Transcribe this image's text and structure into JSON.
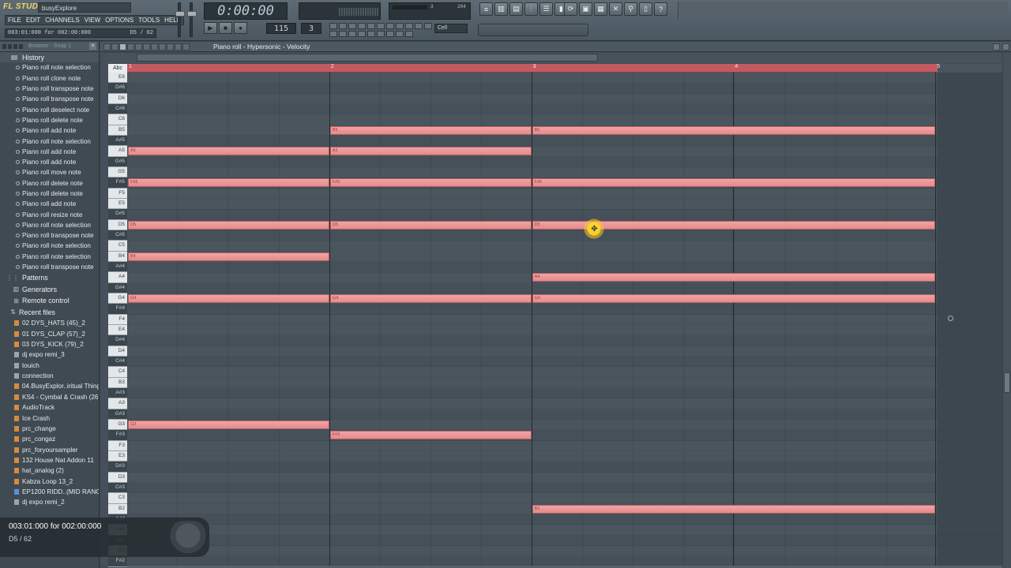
{
  "app": {
    "logo": "FL STUDIO",
    "song_name": "busyExplore",
    "menu": [
      "FILE",
      "EDIT",
      "CHANNELS",
      "VIEW",
      "OPTIONS",
      "TOOLS",
      "HELP"
    ],
    "hint_left": "003:01:000 for 002:00:000",
    "hint_right": "D5 / 62",
    "time": "0:00:00",
    "tempo": "115",
    "pattern": "3",
    "cpu_value_1": "3",
    "cpu_value_2": "204",
    "snap": "Cell"
  },
  "browser": {
    "title": "Browser - Snap 1",
    "history_label": "History",
    "history": [
      "Piano roll note selection",
      "Piano roll clone note",
      "Piano roll transpose note",
      "Piano roll transpose note",
      "Piano roll deselect note",
      "Piano roll delete note",
      "Piano roll add note",
      "Piano roll note selection",
      "Piano roll add note",
      "Piano roll add note",
      "Piano roll move note",
      "Piano roll delete note",
      "Piano roll delete note",
      "Piano roll add note",
      "Piano roll resize note",
      "Piano roll note selection",
      "Piano roll transpose note",
      "Piano roll note selection",
      "Piano roll note selection",
      "Piano roll transpose note"
    ],
    "sections": [
      "Patterns",
      "Generators",
      "Remote control"
    ],
    "recent_label": "Recent files",
    "recent": [
      {
        "name": "02 DYS_HATS (45)_2",
        "icon": "orange"
      },
      {
        "name": "01 DYS_CLAP (57)_2",
        "icon": "orange"
      },
      {
        "name": "03 DYS_KICK (79)_2",
        "icon": "orange"
      },
      {
        "name": "dj expo remi_3",
        "icon": "gray"
      },
      {
        "name": "touich",
        "icon": "gray"
      },
      {
        "name": "connection",
        "icon": "gray"
      },
      {
        "name": "04.BusyExplor..iritual Thing",
        "icon": "orange"
      },
      {
        "name": "KS4 - Cymbal & Crash (26)",
        "icon": "orange"
      },
      {
        "name": "AudioTrack",
        "icon": "orange"
      },
      {
        "name": "Ice Crash",
        "icon": "orange"
      },
      {
        "name": "prc_change",
        "icon": "orange"
      },
      {
        "name": "prc_congaz",
        "icon": "orange"
      },
      {
        "name": "prc_foryoursampler",
        "icon": "orange"
      },
      {
        "name": "132 House Nat Addon 11",
        "icon": "orange"
      },
      {
        "name": "hat_analog (2)",
        "icon": "orange"
      },
      {
        "name": "Kabza Loop 13_2",
        "icon": "orange"
      },
      {
        "name": "EP1200 RIDD..(MID RANGE)",
        "icon": "blue"
      },
      {
        "name": "dj expo remi_2",
        "icon": "gray"
      }
    ]
  },
  "hint_overlay": {
    "line1": "003:01:000 for 002:00:000",
    "line2": "D5 / 62"
  },
  "piano_roll": {
    "title": "Piano roll - Hypersonic - Velocity",
    "abc": "Abc",
    "bar_numbers": [
      "1",
      "2",
      "3",
      "4",
      "5"
    ],
    "keys": [
      "E6",
      "D#6",
      "D6",
      "C#6",
      "C6",
      "B5",
      "A#5",
      "A5",
      "G#5",
      "G5",
      "F#5",
      "F5",
      "E5",
      "D#5",
      "D5",
      "C#5",
      "C5",
      "B4",
      "A#4",
      "A4",
      "G#4",
      "G4",
      "F#4",
      "F4",
      "E4",
      "D#4",
      "D4",
      "C#4",
      "C4",
      "B3",
      "A#3",
      "A3",
      "G#3",
      "G3",
      "F#3",
      "F3",
      "E3",
      "D#3",
      "D3",
      "C#3",
      "C3",
      "B2",
      "A#2",
      "A2",
      "G#2",
      "G2",
      "F#2"
    ],
    "notes": [
      {
        "label": "B5",
        "key": "B5",
        "start": 2,
        "length": 1
      },
      {
        "label": "B5",
        "key": "B5",
        "start": 3,
        "length": 2
      },
      {
        "label": "A5",
        "key": "A5",
        "start": 1,
        "length": 1
      },
      {
        "label": "A5",
        "key": "A5",
        "start": 2,
        "length": 1
      },
      {
        "label": "F#5",
        "key": "F#5",
        "start": 1,
        "length": 1
      },
      {
        "label": "F#5",
        "key": "F#5",
        "start": 2,
        "length": 1
      },
      {
        "label": "F#5",
        "key": "F#5",
        "start": 3,
        "length": 2
      },
      {
        "label": "D5",
        "key": "D5",
        "start": 1,
        "length": 1
      },
      {
        "label": "D5",
        "key": "D5",
        "start": 2,
        "length": 1
      },
      {
        "label": "D5",
        "key": "D5",
        "start": 3,
        "length": 2
      },
      {
        "label": "B4",
        "key": "B4",
        "start": 1,
        "length": 1
      },
      {
        "label": "A4",
        "key": "A4",
        "start": 3,
        "length": 2
      },
      {
        "label": "G4",
        "key": "G4",
        "start": 1,
        "length": 1
      },
      {
        "label": "G4",
        "key": "G4",
        "start": 2,
        "length": 1
      },
      {
        "label": "G4",
        "key": "G4",
        "start": 3,
        "length": 2
      },
      {
        "label": "G3",
        "key": "G3",
        "start": 1,
        "length": 1
      },
      {
        "label": "F#3",
        "key": "F#3",
        "start": 2,
        "length": 1
      },
      {
        "label": "B2",
        "key": "B2",
        "start": 3,
        "length": 2
      }
    ],
    "accent_color": "#e38a8c"
  }
}
